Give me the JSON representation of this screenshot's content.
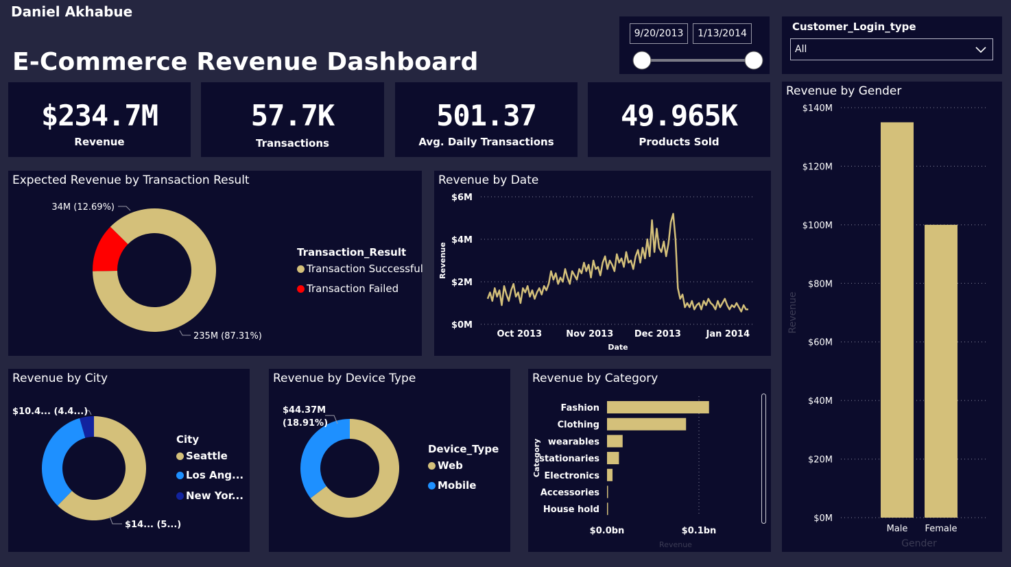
{
  "header": {
    "author": "Daniel Akhabue",
    "title": "E-Commerce Revenue Dashboard"
  },
  "date_slicer": {
    "start": "9/20/2013",
    "end": "1/13/2014"
  },
  "login_slicer": {
    "label": "Customer_Login_type",
    "value": "All"
  },
  "kpis": [
    {
      "value": "$234.7M",
      "label": "Revenue"
    },
    {
      "value": "57.7K",
      "label": "Transactions"
    },
    {
      "value": "501.37",
      "label": "Avg. Daily Transactions"
    },
    {
      "value": "49.965K",
      "label": "Products Sold"
    }
  ],
  "colors": {
    "gold": "#d4c07a",
    "red": "#ff0000",
    "blue": "#1e90ff",
    "navy": "#12239e",
    "panel": "#0c0c2c",
    "page": "#252640"
  },
  "chart_data": [
    {
      "type": "pie",
      "title": "Expected Revenue by Transaction Result",
      "legend_title": "Transaction_Result",
      "legend_placement": "right",
      "slices": [
        {
          "name": "Transaction Successful",
          "value": 235,
          "percent": 87.31,
          "label": "235M (87.31%)",
          "color": "#d4c07a"
        },
        {
          "name": "Transaction Failed",
          "value": 34,
          "percent": 12.69,
          "label": "34M (12.69%)",
          "color": "#ff0000"
        }
      ]
    },
    {
      "type": "line",
      "title": "Revenue by Date",
      "xlabel": "Date",
      "ylabel": "Revenue",
      "y_ticks": [
        "$6M",
        "$4M",
        "$2M",
        "$0M"
      ],
      "x_ticks": [
        "Oct 2013",
        "Nov 2013",
        "Dec 2013",
        "Jan 2014"
      ],
      "ylim": [
        0,
        6
      ],
      "unit": "M",
      "color": "#d4c07a",
      "x_start": "2013-09-20",
      "x_end": "2014-01-13",
      "values": [
        1.2,
        1.5,
        1.1,
        1.7,
        1.3,
        1.6,
        0.9,
        1.8,
        1.4,
        1.1,
        1.6,
        1.9,
        1.3,
        1.5,
        1.0,
        1.7,
        1.5,
        1.8,
        1.3,
        1.6,
        1.2,
        1.5,
        1.7,
        1.4,
        1.8,
        1.6,
        1.9,
        2.5,
        2.1,
        2.4,
        1.9,
        2.2,
        2.0,
        2.6,
        2.2,
        1.9,
        2.5,
        2.3,
        2.1,
        2.6,
        2.4,
        2.9,
        2.5,
        2.8,
        2.2,
        3.0,
        2.6,
        2.7,
        2.3,
        2.9,
        3.2,
        2.6,
        3.0,
        2.8,
        2.5,
        3.3,
        2.9,
        3.1,
        2.7,
        3.4,
        2.9,
        3.0,
        2.6,
        3.2,
        3.5,
        2.9,
        3.6,
        3.1,
        4.0,
        3.2,
        4.9,
        3.4,
        4.5,
        3.6,
        3.4,
        3.9,
        3.2,
        3.8,
        4.8,
        5.2,
        4.0,
        1.7,
        1.2,
        1.4,
        0.8,
        1.0,
        0.8,
        1.1,
        0.7,
        0.9,
        1.0,
        0.7,
        1.1,
        0.9,
        1.2,
        1.0,
        0.9,
        0.7,
        1.1,
        0.8,
        1.0,
        1.2,
        0.9,
        0.7,
        0.9,
        0.8,
        1.0,
        0.8,
        0.6,
        0.9,
        0.7,
        0.7
      ]
    },
    {
      "type": "bar",
      "title": "Revenue by Gender",
      "xlabel": "Gender",
      "ylabel": "Revenue",
      "categories": [
        "Male",
        "Female"
      ],
      "values": [
        135,
        100
      ],
      "unit": "M",
      "ylim": [
        0,
        140
      ],
      "y_ticks": [
        "$140M",
        "$120M",
        "$100M",
        "$80M",
        "$60M",
        "$40M",
        "$20M",
        "$0M"
      ],
      "color": "#d4c07a"
    },
    {
      "type": "pie",
      "title": "Revenue by City",
      "legend_title": "City",
      "slices": [
        {
          "name": "Seattle",
          "value": 146,
          "label": "$14... (5...)",
          "color": "#d4c07a"
        },
        {
          "name": "Los Ang...",
          "value": 78,
          "color": "#1e90ff"
        },
        {
          "name": "New Yor...",
          "value": 10.4,
          "label": "$10.4... (4.4...)",
          "color": "#12239e"
        }
      ]
    },
    {
      "type": "pie",
      "title": "Revenue by Device Type",
      "legend_title": "Device_Type",
      "slices": [
        {
          "name": "Web",
          "value": 81.09,
          "color": "#d4c07a"
        },
        {
          "name": "Mobile",
          "value": 44.37,
          "percent": 18.91,
          "label": "$44.37M",
          "label2": "(18.91%)",
          "color": "#1e90ff"
        }
      ]
    },
    {
      "type": "bar",
      "orientation": "horizontal",
      "title": "Revenue by Category",
      "xlabel": "Revenue",
      "ylabel": "Category",
      "categories": [
        "Fashion",
        "Clothing",
        "wearables",
        "stationaries",
        "Electronics",
        "Accessories",
        "House hold"
      ],
      "values": [
        0.111,
        0.086,
        0.017,
        0.013,
        0.006,
        0.001,
        0.001
      ],
      "unit": "bn",
      "x_ticks": [
        "$0.0bn",
        "$0.1bn"
      ],
      "xlim": [
        0,
        0.1
      ],
      "color": "#d4c07a"
    }
  ]
}
